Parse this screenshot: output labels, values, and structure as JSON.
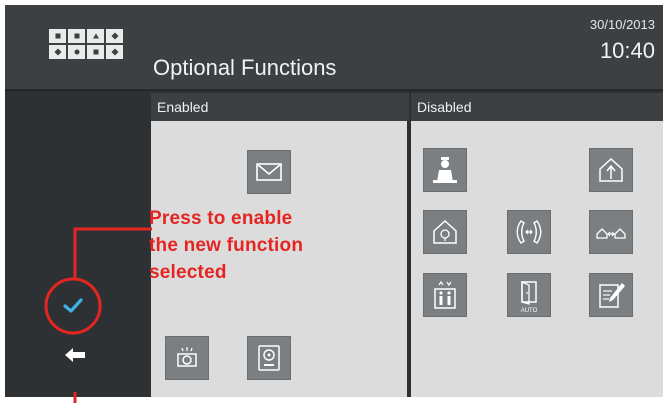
{
  "header": {
    "title": "Optional Functions",
    "date": "30/10/2013",
    "time": "10:40"
  },
  "panels": {
    "enabled": {
      "label": "Enabled",
      "tiles": [
        "message-icon",
        "camera-icon",
        "monitor-intercom-icon"
      ]
    },
    "disabled": {
      "label": "Disabled",
      "tiles": [
        "doorman-icon",
        "home-arrow-icon",
        "home-light-icon",
        "handsfree-call-icon",
        "home-transfer-icon",
        "lift-icon",
        "auto-door-icon",
        "notepad-icon"
      ],
      "auto_label": "AUTO"
    }
  },
  "sidebar": {
    "confirm_icon": "checkmark-icon",
    "back_icon": "back-arrow-icon"
  },
  "annotation": {
    "text_line1": "Press to enable",
    "text_line2": "the new function",
    "text_line3": "selected",
    "color": "#e52521"
  },
  "colors": {
    "screen_bg": "#2d3133",
    "header_bg": "#3c4042",
    "panel_bg": "#dcdcdc",
    "tile_bg": "#7b7f81",
    "check_color": "#3fb3e6"
  }
}
